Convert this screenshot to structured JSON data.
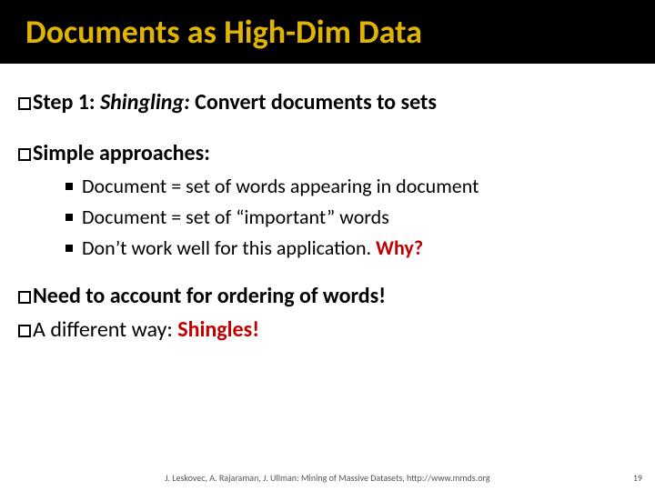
{
  "title": "Documents as High-Dim Data",
  "top": {
    "label": "Step 1: ",
    "shingling": "Shingling:",
    "rest": " Convert documents to sets"
  },
  "approaches": {
    "label": "Simple approaches:",
    "items": [
      "Document = set of words appearing in document",
      "Document = set of “important” words",
      "Don’t work well for this application."
    ],
    "why": " Why?"
  },
  "need": "Need to account for ordering of words!",
  "alt": {
    "lead": "A different way: ",
    "shingles": "Shingles!"
  },
  "footer": "J. Leskovec, A. Rajaraman, J. Ullman: Mining of Massive Datasets, http://www.mmds.org",
  "page": "19"
}
